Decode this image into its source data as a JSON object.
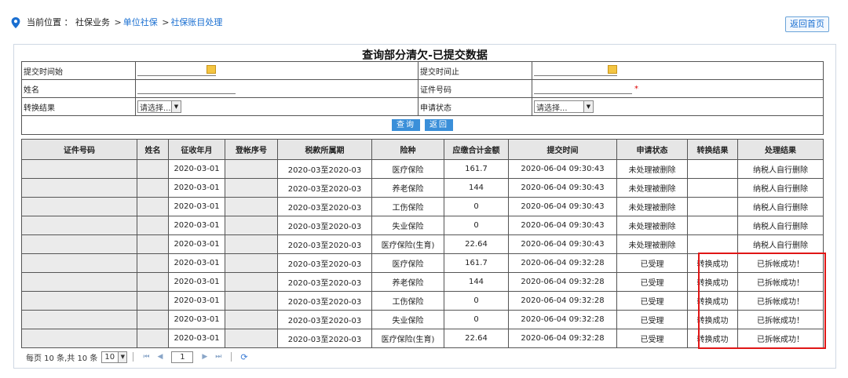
{
  "breadcrumb": {
    "label": "当前位置 ：",
    "root": "社保业务",
    "sep": ">",
    "level2": "单位社保",
    "level3": "社保账目处理"
  },
  "home_button": "返回首页",
  "panel_title": "查询部分清欠-已提交数据",
  "form": {
    "submit_time_start": "提交时间始",
    "submit_time_end": "提交时间止",
    "name": "姓名",
    "id_number": "证件号码",
    "required_mark": "*",
    "convert_result": "转换结果",
    "convert_result_value": "请选择...",
    "apply_status": "申请状态",
    "apply_status_value": "请选择...",
    "query_button": "查询",
    "back_button": "返回"
  },
  "table": {
    "headers": [
      "证件号码",
      "姓名",
      "征收年月",
      "登帐序号",
      "税款所属期",
      "险种",
      "应缴合计金额",
      "提交时间",
      "申请状态",
      "转换结果",
      "处理结果"
    ],
    "rows": [
      [
        "",
        "",
        "2020-03-01",
        "",
        "2020-03至2020-03",
        "医疗保险",
        "161.7",
        "2020-06-04 09:30:43",
        "未处理被删除",
        "",
        "纳税人自行删除"
      ],
      [
        "",
        "",
        "2020-03-01",
        "",
        "2020-03至2020-03",
        "养老保险",
        "144",
        "2020-06-04 09:30:43",
        "未处理被删除",
        "",
        "纳税人自行删除"
      ],
      [
        "",
        "",
        "2020-03-01",
        "",
        "2020-03至2020-03",
        "工伤保险",
        "0",
        "2020-06-04 09:30:43",
        "未处理被删除",
        "",
        "纳税人自行删除"
      ],
      [
        "",
        "",
        "2020-03-01",
        "",
        "2020-03至2020-03",
        "失业保险",
        "0",
        "2020-06-04 09:30:43",
        "未处理被删除",
        "",
        "纳税人自行删除"
      ],
      [
        "",
        "",
        "2020-03-01",
        "",
        "2020-03至2020-03",
        "医疗保险(生育)",
        "22.64",
        "2020-06-04 09:30:43",
        "未处理被删除",
        "",
        "纳税人自行删除"
      ],
      [
        "",
        "",
        "2020-03-01",
        "",
        "2020-03至2020-03",
        "医疗保险",
        "161.7",
        "2020-06-04 09:32:28",
        "已受理",
        "转换成功",
        "已拆帐成功！"
      ],
      [
        "",
        "",
        "2020-03-01",
        "",
        "2020-03至2020-03",
        "养老保险",
        "144",
        "2020-06-04 09:32:28",
        "已受理",
        "转换成功",
        "已拆帐成功！"
      ],
      [
        "",
        "",
        "2020-03-01",
        "",
        "2020-03至2020-03",
        "工伤保险",
        "0",
        "2020-06-04 09:32:28",
        "已受理",
        "转换成功",
        "已拆帐成功！"
      ],
      [
        "",
        "",
        "2020-03-01",
        "",
        "2020-03至2020-03",
        "失业保险",
        "0",
        "2020-06-04 09:32:28",
        "已受理",
        "转换成功",
        "已拆帐成功！"
      ],
      [
        "",
        "",
        "2020-03-01",
        "",
        "2020-03至2020-03",
        "医疗保险(生育)",
        "22.64",
        "2020-06-04 09:32:28",
        "已受理",
        "转换成功",
        "已拆帐成功！"
      ]
    ]
  },
  "pager": {
    "summary": "每页 10 条,共 10 条",
    "page_size": "10",
    "current_page": "1",
    "first": "⏮",
    "prev": "◀",
    "next": "▶",
    "last": "⏭",
    "refresh": "⟳"
  },
  "colors": {
    "link": "#1a6fd1",
    "highlight_box": "#e01616",
    "button_blue": "#3a8fd9"
  },
  "icons": {
    "location": "location-pin-icon",
    "calendar": "calendar-icon",
    "dropdown": "chevron-down-icon",
    "refresh": "refresh-icon"
  }
}
